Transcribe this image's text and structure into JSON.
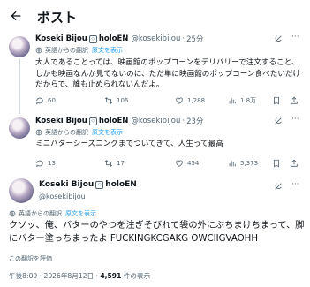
{
  "header": {
    "title": "ポスト"
  },
  "common": {
    "translated_label": "英語からの翻訳",
    "show_original": "原文を表示",
    "more": "···"
  },
  "tweets": [
    {
      "name": "Koseki Bijou",
      "affiliation": "holoEN",
      "handle": "@kosekibijou",
      "dot": "·",
      "time": "25分",
      "text": "大人であることっては、映画館のポップコーンをデリバリーで注文すること、しかも映画なんか見てないのに、ただ単に映画館のポップコーン食べたいだけだからで、誰も止められないんだよ。",
      "replies": "60",
      "reposts": "106",
      "likes": "1,288",
      "views": "1.8万"
    },
    {
      "name": "Koseki Bijou",
      "affiliation": "holoEN",
      "handle": "@kosekibijou",
      "dot": "·",
      "time": "23分",
      "text": "ミニバターシーズニングまでついてきて、人生って最高",
      "replies": "13",
      "reposts": "17",
      "likes": "454",
      "views": "5,373"
    }
  ],
  "main": {
    "name": "Koseki Bijou",
    "affiliation": "holoEN",
    "handle": "@kosekibijou",
    "text": "クソッ、俺、バターのやつを注ぎそびれて袋の外にぶちまけちまって、脚にバター塗っちまったよ FUCKINGKCGAKG OWCIIGVAOHH",
    "rate_translation": "この翻訳を評価",
    "time": "午後8:09",
    "date": "2026年8月12日",
    "views_count": "4,591",
    "views_label": "件の表示"
  },
  "colors": {
    "accent": "#1d9bf0",
    "muted": "#536471"
  }
}
